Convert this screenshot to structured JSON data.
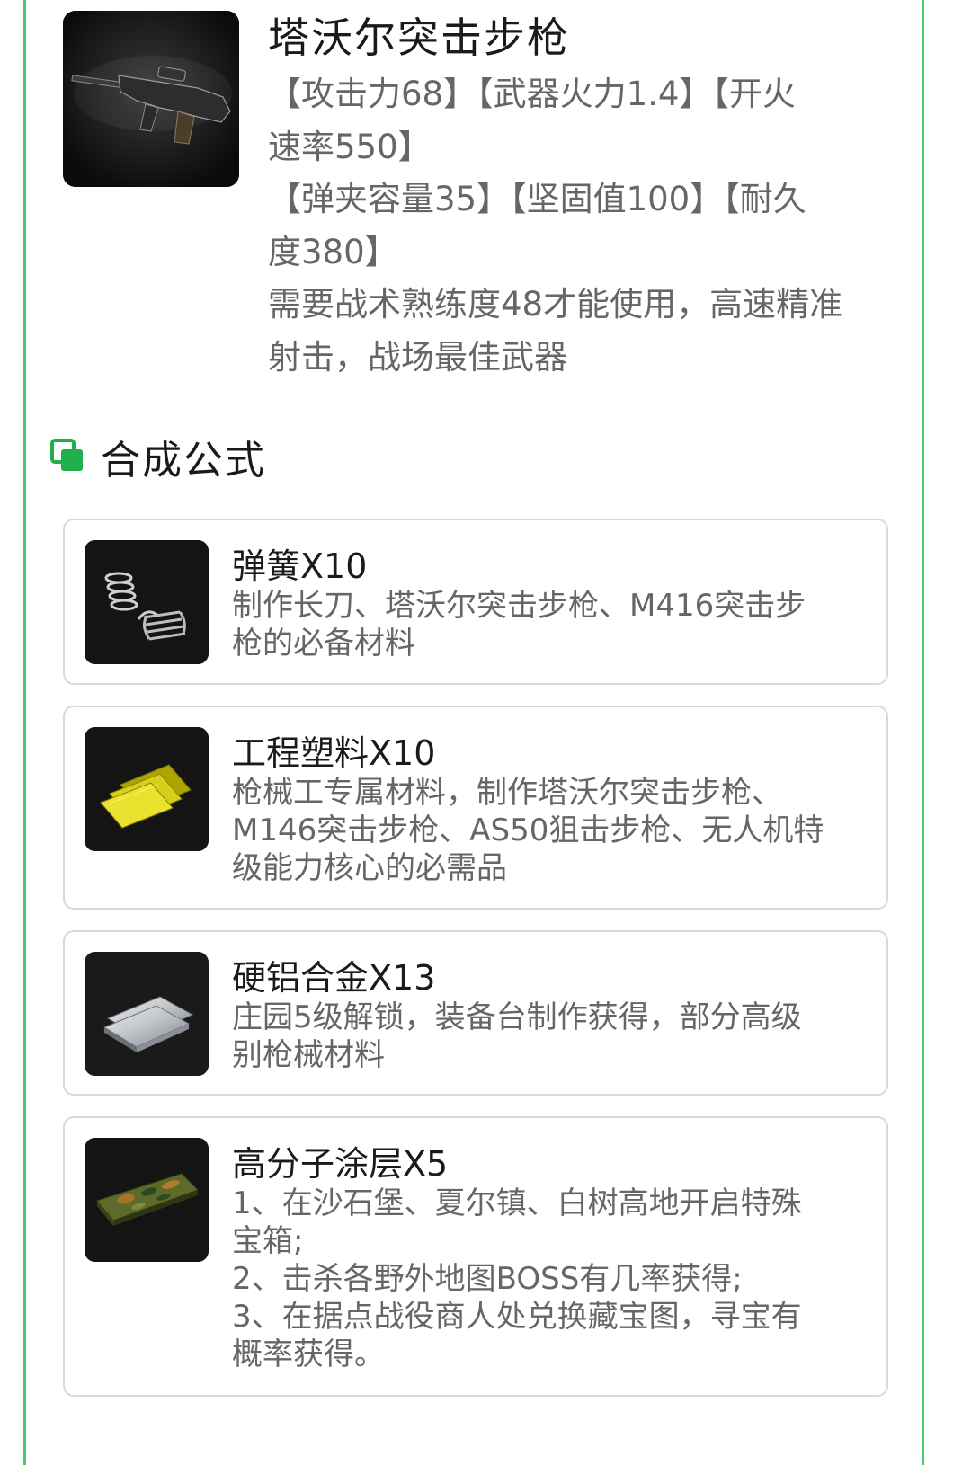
{
  "weapon": {
    "name": "塔沃尔突击步枪",
    "icon": "assault-rifle-image",
    "stats_lines": [
      "【攻击力68】【武器火力1.4】【开火",
      "速率550】",
      "【弹夹容量35】【坚固值100】【耐久",
      "度380】",
      "需要战术熟练度48才能使用，高速精准",
      "射击，战场最佳武器"
    ]
  },
  "section": {
    "title": "合成公式",
    "icon": "copy-squares-icon",
    "accent_color": "#20b04b"
  },
  "frame_color": "#4cc968",
  "materials": [
    {
      "name": "弹簧X10",
      "icon": "spring-image",
      "desc_lines": [
        "制作长刀、塔沃尔突击步枪、M416突击步",
        "枪的必备材料"
      ]
    },
    {
      "name": "工程塑料X10",
      "icon": "plastic-sheets-image",
      "desc_lines": [
        "枪械工专属材料，制作塔沃尔突击步枪、",
        "M146突击步枪、AS50狙击步枪、无人机特",
        "级能力核心的必需品"
      ]
    },
    {
      "name": "硬铝合金X13",
      "icon": "aluminum-plates-image",
      "desc_lines": [
        "庄园5级解锁，装备台制作获得，部分高级",
        "别枪械材料"
      ]
    },
    {
      "name": "高分子涂层X5",
      "icon": "camo-coating-image",
      "desc_lines": [
        "1、在沙石堡、夏尔镇、白树高地开启特殊",
        "宝箱;",
        "2、击杀各野外地图BOSS有几率获得;",
        "3、在据点战役商人处兑换藏宝图，寻宝有",
        "概率获得。"
      ]
    }
  ]
}
